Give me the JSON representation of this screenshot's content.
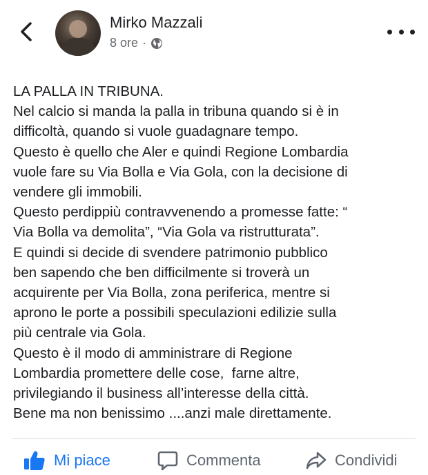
{
  "header": {
    "author": "Mirko Mazzali",
    "time": "8 ore",
    "separator": "·",
    "privacy_icon": "globe-icon",
    "back_icon": "chevron-left-icon",
    "more_icon": "more-dots-icon"
  },
  "post": {
    "lines": [
      "LA PALLA IN TRIBUNA.",
      "Nel calcio si manda la palla in tribuna quando si è in",
      "difficoltà, quando si vuole guadagnare tempo.",
      "Questo è quello che Aler e quindi Regione Lombardia",
      "vuole fare su Via Bolla e Via Gola, con la decisione di",
      "vendere gli immobili.",
      "Questo perdippiù contravvenendo a promesse fatte: “",
      "Via Bolla va demolita”, “Via Gola va ristrutturata”.",
      "E quindi si decide di svendere patrimonio pubblico",
      "ben sapendo che ben difficilmente si troverà un",
      "acquirente per Via Bolla, zona periferica, mentre si",
      "aprono le porte a possibili speculazioni edilizie sulla",
      "più centrale via Gola.",
      "Questo è il modo di amministrare di Regione",
      "Lombardia promettere delle cose,  farne altre,",
      "privilegiando il business all’interesse della città.",
      "Bene ma non benissimo ....anzi male direttamente."
    ]
  },
  "actions": {
    "like_label": "Mi piace",
    "comment_label": "Commenta",
    "share_label": "Condividi",
    "like_icon": "thumbs-up-icon",
    "comment_icon": "comment-bubble-icon",
    "share_icon": "share-arrow-icon"
  },
  "colors": {
    "accent": "#1877f2",
    "text": "#1c1e21",
    "secondary": "#65676b"
  }
}
